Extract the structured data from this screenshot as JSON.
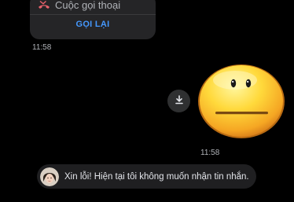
{
  "call_card": {
    "icon": "missed-call-icon",
    "title": "Cuộc gọi thoại",
    "action_label": "GỌI LẠI",
    "action_color": "#4599ff",
    "icon_color": "#e8616b"
  },
  "timestamps": {
    "call": "11:58",
    "sticker": "11:58"
  },
  "download_button": {
    "icon": "download-icon"
  },
  "sticker": {
    "icon": "neutral-face-emoji"
  },
  "auto_reply": {
    "text": "Xin lỗi! Hiện tại tôi không muốn nhận tin nhắn.",
    "avatar": "contact-avatar"
  }
}
